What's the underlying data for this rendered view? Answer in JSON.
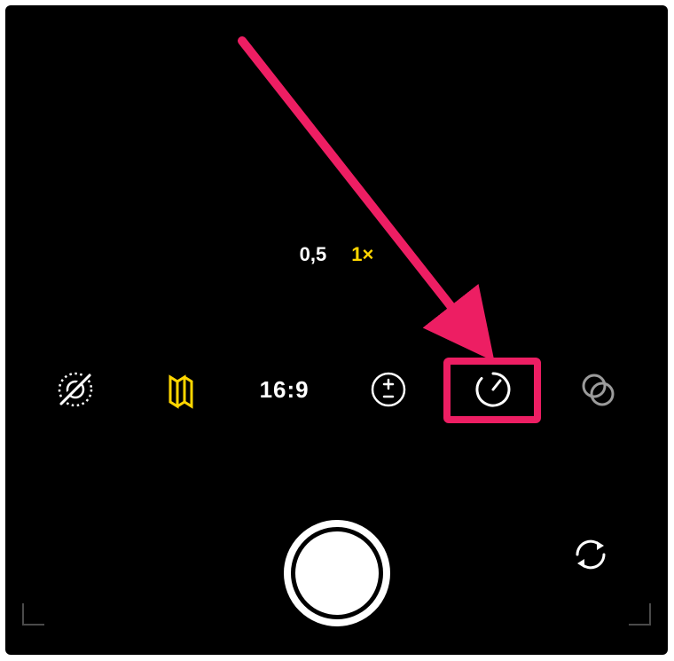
{
  "zoom": {
    "wide_label": "0,5",
    "selected_label": "1×"
  },
  "toolbar": {
    "aspect_ratio": "16:9"
  },
  "colors": {
    "accent_yellow": "#FFD600",
    "highlight_pink": "#ED1E63"
  },
  "icons": {
    "live_photo": "live-photo-off-icon",
    "photographic_styles": "styles-icon",
    "exposure": "exposure-icon",
    "timer": "timer-icon",
    "filters": "filters-icon",
    "shutter": "shutter-button",
    "flip": "flip-camera-icon"
  }
}
